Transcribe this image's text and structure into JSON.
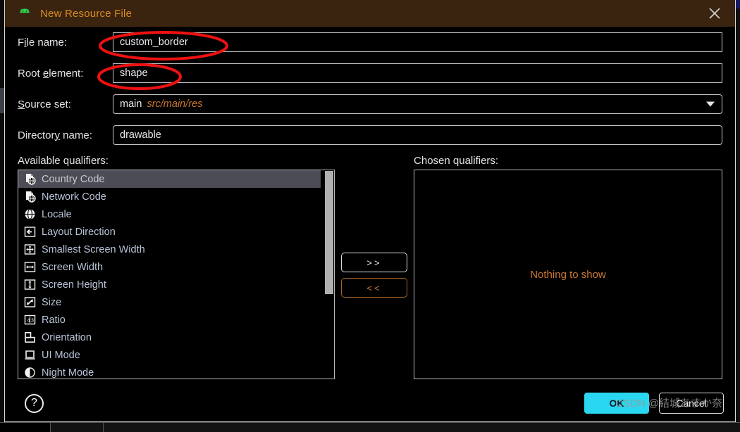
{
  "window": {
    "title": "New Resource File",
    "app_icon": "android-robot-icon",
    "close_icon": "close-icon",
    "titlebar_color": "#3a2410",
    "title_color": "#d98c22"
  },
  "form": {
    "rows": [
      {
        "label_pre": "F",
        "label_mn": "i",
        "label_post": "le name:",
        "label": "File name:",
        "value": "custom_border",
        "sub": "",
        "type": "text",
        "name": "file-name"
      },
      {
        "label_pre": "Root ",
        "label_mn": "e",
        "label_post": "lement:",
        "label": "Root element:",
        "value": "shape",
        "sub": "",
        "type": "text",
        "name": "root-element"
      },
      {
        "label_pre": "",
        "label_mn": "S",
        "label_post": "ource set:",
        "label": "Source set:",
        "value": "main",
        "sub": "src/main/res",
        "type": "select",
        "name": "source-set"
      },
      {
        "label_pre": "Director",
        "label_mn": "y",
        "label_post": " name:",
        "label": "Directory name:",
        "value": "drawable",
        "sub": "",
        "type": "text",
        "name": "directory-name"
      }
    ]
  },
  "qualifiers": {
    "available_label_pre": "A",
    "available_label_mn": "v",
    "available_label_post": "ailable qualifiers:",
    "available_label": "Available qualifiers:",
    "chosen_label_pre": "C",
    "chosen_label_mn": "h",
    "chosen_label_post": "osen qualifiers:",
    "chosen_label": "Chosen qualifiers:",
    "available": [
      {
        "label": "Country Code",
        "icon": "file-globe-icon",
        "selected": true
      },
      {
        "label": "Network Code",
        "icon": "file-network-icon",
        "selected": false
      },
      {
        "label": "Locale",
        "icon": "globe-icon",
        "selected": false
      },
      {
        "label": "Layout Direction",
        "icon": "arrow-left-icon",
        "selected": false
      },
      {
        "label": "Smallest Screen Width",
        "icon": "arrows-four-way-icon",
        "selected": false
      },
      {
        "label": "Screen Width",
        "icon": "arrows-horizontal-icon",
        "selected": false
      },
      {
        "label": "Screen Height",
        "icon": "arrows-vertical-icon",
        "selected": false
      },
      {
        "label": "Size",
        "icon": "diagonal-arrow-icon",
        "selected": false
      },
      {
        "label": "Ratio",
        "icon": "ratio-icon",
        "selected": false
      },
      {
        "label": "Orientation",
        "icon": "orientation-icon",
        "selected": false
      },
      {
        "label": "UI Mode",
        "icon": "ui-mode-icon",
        "selected": false
      },
      {
        "label": "Night Mode",
        "icon": "night-mode-icon",
        "selected": false
      }
    ],
    "add_button": ">>",
    "remove_button": "<<",
    "chosen_empty_text": "Nothing to show",
    "empty_text_color": "#cc7832"
  },
  "footer": {
    "help_icon": "question-mark-icon",
    "ok_label": "OK",
    "cancel_label": "Cancel",
    "ok_color": "#2ad7f0"
  },
  "watermark": {
    "text": "CSDN @結城あすか奈"
  }
}
